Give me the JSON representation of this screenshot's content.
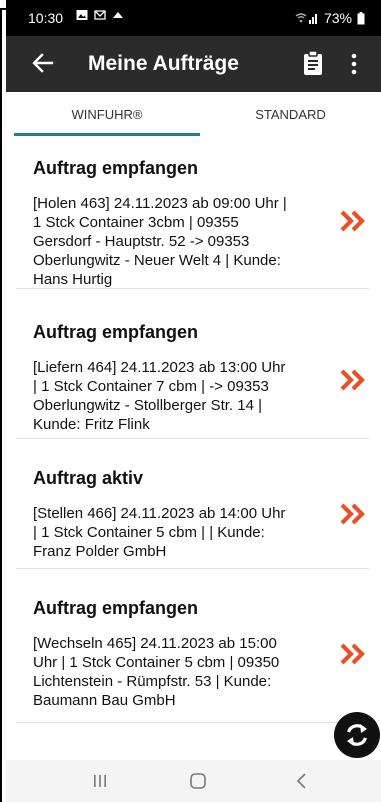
{
  "status_bar": {
    "time": "10:30",
    "battery": "73%",
    "icons": [
      "gallery-icon",
      "gmail-icon",
      "cloud-icon",
      "wifi-icon",
      "signal-icon",
      "battery-icon"
    ]
  },
  "appbar": {
    "title": "Meine Aufträge",
    "back_icon": "arrow-back-icon",
    "action_icon": "clipboard-icon",
    "menu_icon": "more-vert-icon"
  },
  "tabs": [
    {
      "label": "WINFUHR®",
      "selected": true
    },
    {
      "label": "STANDARD",
      "selected": false
    }
  ],
  "accent_color": "#2a7d84",
  "chevron_color": "#e8502a",
  "orders": [
    {
      "title": "Auftrag empfangen",
      "lines": [
        "[Holen 463] 24.11.2023 ab 09:00 Uhr |",
        "1 Stck Container 3cbm |  09355",
        "Gersdorf - Hauptstr.  52  -> 09353",
        "Oberlungwitz - Neuer  Welt  4  | Kunde:",
        "Hans Hurtig"
      ]
    },
    {
      "title": "Auftrag empfangen",
      "lines": [
        "[Liefern 464] 24.11.2023 ab 13:00 Uhr",
        "| 1 Stck Container 7 cbm |  -> 09353",
        "Oberlungwitz - Stollberger  Str.  14  |",
        "Kunde: Fritz Flink"
      ]
    },
    {
      "title": "Auftrag aktiv",
      "lines": [
        "[Stellen 466] 24.11.2023 ab 14:00 Uhr",
        "| 1 Stck Container 5 cbm |  | Kunde:",
        "Franz Polder GmbH"
      ]
    },
    {
      "title": "Auftrag empfangen",
      "lines": [
        "[Wechseln 465] 24.11.2023 ab 15:00",
        "Uhr | 1 Stck Container 5 cbm |  09350",
        "Lichtenstein - Rümpfstr.  53  | Kunde:",
        "Baumann Bau GmbH"
      ]
    }
  ],
  "fab_icon": "sync-icon",
  "nav_icons": [
    "recents-icon",
    "home-icon",
    "back-icon"
  ]
}
